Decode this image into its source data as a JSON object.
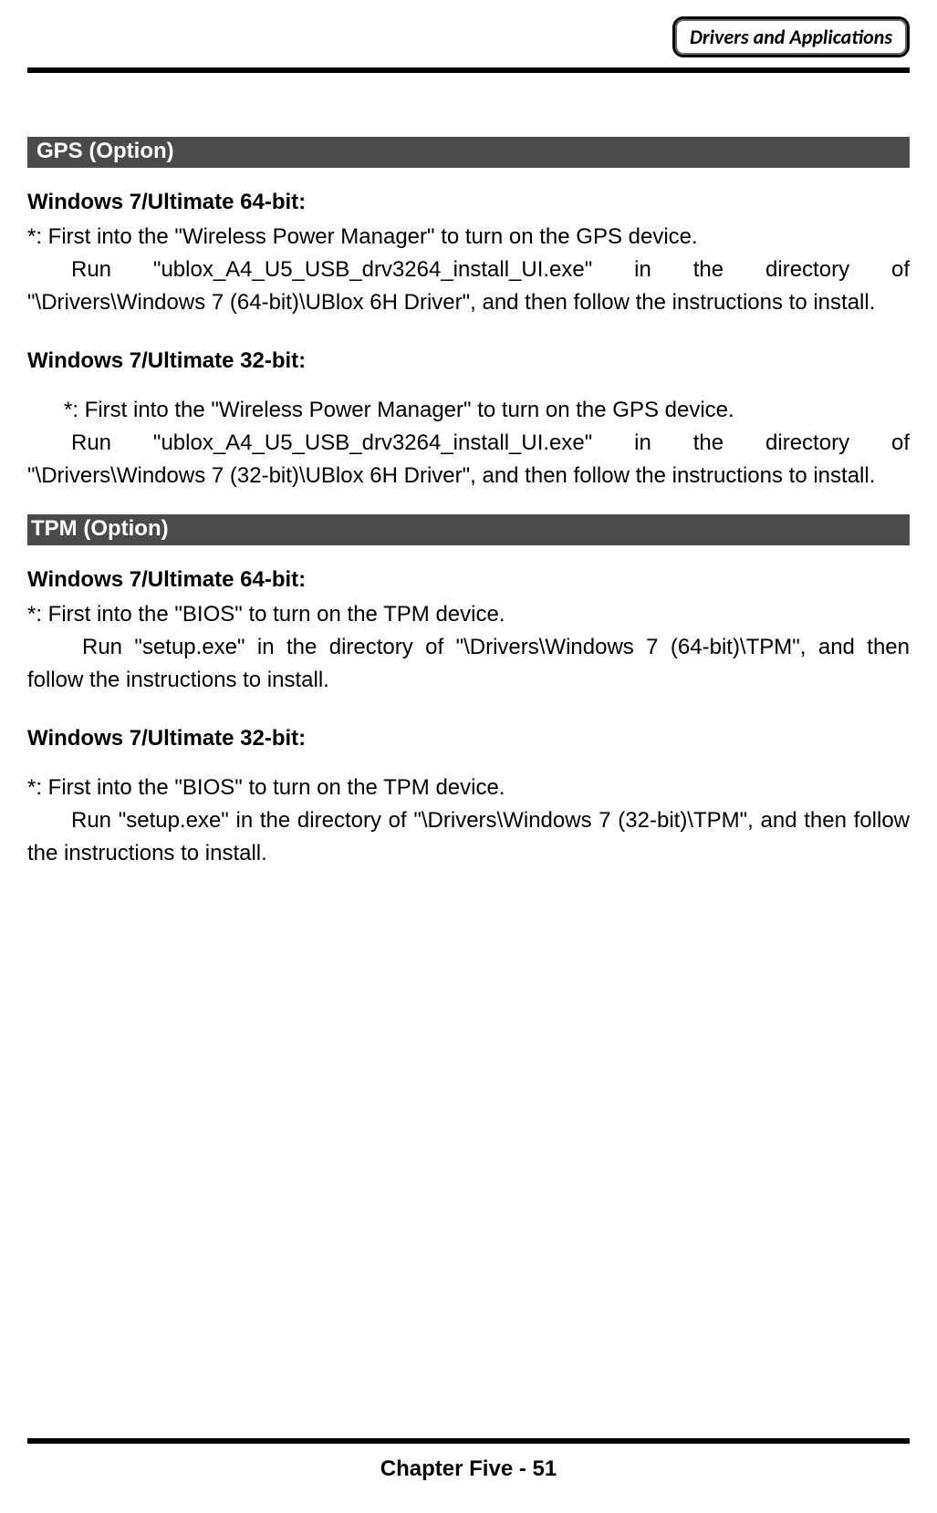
{
  "header": {
    "badge": "Drivers and Applications"
  },
  "sections": {
    "gps": {
      "title": " GPS (Option)",
      "win64": {
        "heading": "Windows 7/Ultimate 64-bit:",
        "note": "*: First into the \"Wireless Power Manager\" to turn on the GPS device.",
        "line_a": "Run \"ublox_A4_U5_USB_drv3264_install_UI.exe\" in the directory of",
        "line_b": "\"\\Drivers\\Windows 7 (64-bit)\\UBlox 6H Driver\", and then follow the instructions to install."
      },
      "win32": {
        "heading": "Windows 7/Ultimate 32-bit:",
        "note": "*: First into the \"Wireless Power Manager\" to turn on the GPS device.",
        "line_a": "Run \"ublox_A4_U5_USB_drv3264_install_UI.exe\" in the directory of",
        "line_b": "\"\\Drivers\\Windows 7 (32-bit)\\UBlox 6H Driver\", and then follow the instructions to install."
      }
    },
    "tpm": {
      "title": "TPM (Option)",
      "win64": {
        "heading": "Windows 7/Ultimate 64-bit:",
        "note": "*: First into the \"BIOS\" to turn on the TPM device.",
        "body": "Run \"setup.exe\" in the directory of \"\\Drivers\\Windows 7 (64-bit)\\TPM\", and then follow the instructions to install."
      },
      "win32": {
        "heading": "Windows 7/Ultimate 32-bit:",
        "note": "*: First into the \"BIOS\" to turn on the TPM device.",
        "body": "Run \"setup.exe\" in the directory of \"\\Drivers\\Windows 7 (32-bit)\\TPM\", and then follow the instructions to install."
      }
    }
  },
  "footer": {
    "text": "Chapter Five - 51"
  }
}
